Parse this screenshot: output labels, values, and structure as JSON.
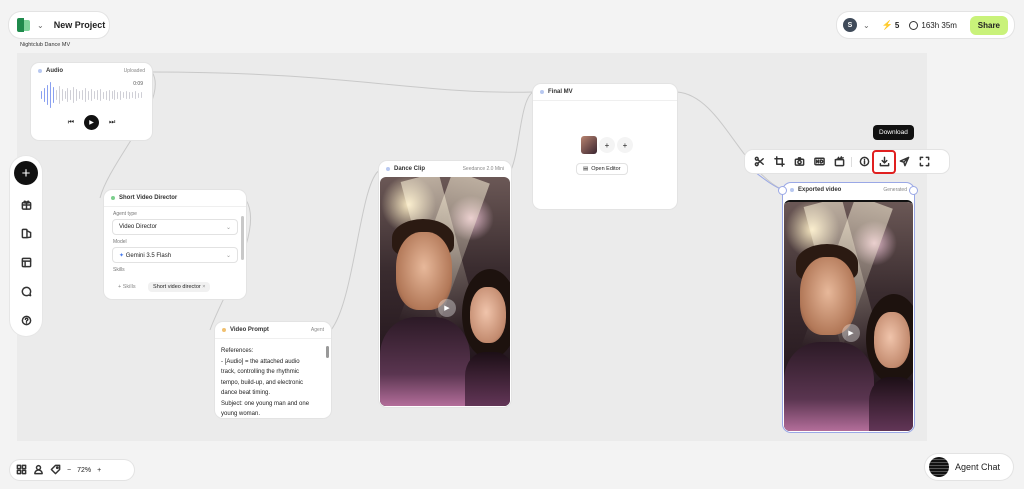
{
  "header": {
    "project_title": "New Project",
    "canvas_tag": "Nightclub Dance MV"
  },
  "account": {
    "avatar_letter": "S",
    "credits": "5",
    "time_remaining": "163h 35m",
    "share_label": "Share"
  },
  "nodes": {
    "audio": {
      "title": "Audio",
      "status": "Uploaded",
      "timestamp": "0:09"
    },
    "director": {
      "title": "Short Video Director",
      "agent_type_label": "Agent type",
      "agent_type_value": "Video Director",
      "model_label": "Model",
      "model_value": "Gemini 3.5 Flash",
      "skills_label": "Skills",
      "skills_button": "+ Skills",
      "skill_chip": "Short video director"
    },
    "prompt": {
      "title": "Video Prompt",
      "meta": "Agent",
      "text": "References:\n- [Audio] = the attached audio\ntrack, controlling the rhythmic\ntempo, build-up, and electronic\ndance beat timing.\nSubject: one young man and one\nyoung woman."
    },
    "dance_clip": {
      "title": "Dance Clip",
      "meta": "Seedance 2.0 Mini"
    },
    "final_mv": {
      "title": "Final MV",
      "open_editor": "Open Editor"
    },
    "exported": {
      "title": "Exported video",
      "meta": "Generated"
    }
  },
  "toolbar": {
    "tooltip": "Download",
    "highlighted_tool": "download-icon"
  },
  "bottom": {
    "zoom": "72%",
    "agent_chat": "Agent Chat"
  },
  "colors": {
    "share_button": "#c9f27a",
    "highlight": "#e02020",
    "accent_green": "#1f8a4c"
  }
}
